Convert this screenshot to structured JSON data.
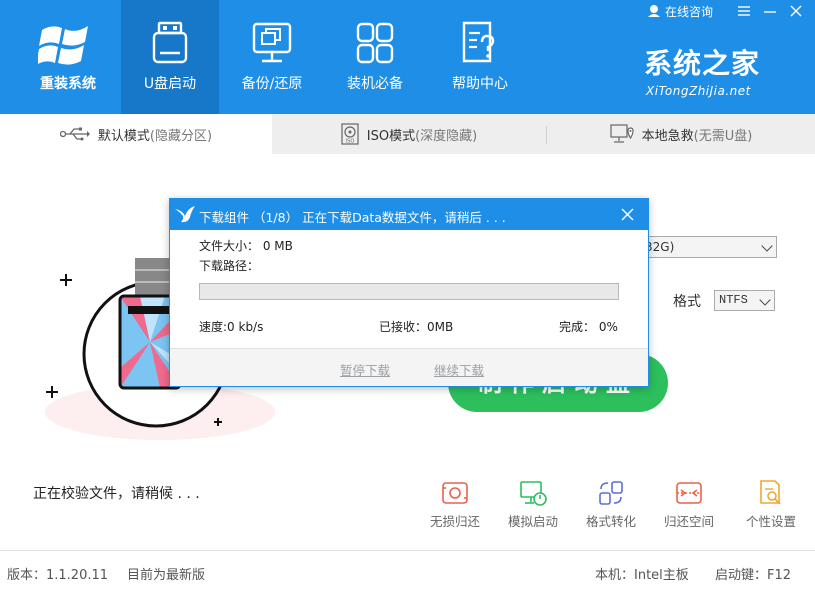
{
  "app": {
    "name": "重装系统"
  },
  "nav": [
    {
      "label": "U盘启动",
      "icon": "usb-drive-icon",
      "active": true
    },
    {
      "label": "备份/还原",
      "icon": "backup-restore-icon",
      "active": false
    },
    {
      "label": "装机必备",
      "icon": "apps-grid-icon",
      "active": false
    },
    {
      "label": "帮助中心",
      "icon": "help-document-icon",
      "active": false
    }
  ],
  "top_right": {
    "consult": "在线咨询"
  },
  "brand": {
    "zh": "系统之家",
    "en": "XiTongZhiJia.net"
  },
  "tabs": [
    {
      "label": "默认模式",
      "hint": "(隐藏分区)",
      "icon": "usb-plug-icon",
      "active": true
    },
    {
      "label": "ISO模式",
      "hint": "(深度隐藏)",
      "icon": "iso-disc-icon",
      "active": false
    },
    {
      "label": "本地急救",
      "hint": "(无需U盘)",
      "icon": "local-rescue-icon",
      "active": false
    }
  ],
  "main": {
    "device_value": "32G)",
    "format_label": "格式",
    "format_value": "NTFS",
    "start_button": "制作启动盘",
    "status": "正在校验文件，请稍候 . . ."
  },
  "tools": [
    {
      "label": "无损归还",
      "icon": "restore-icon",
      "color": "#e8624a"
    },
    {
      "label": "模拟启动",
      "icon": "simulate-boot-icon",
      "color": "#2cbf5c"
    },
    {
      "label": "格式转化",
      "icon": "format-convert-icon",
      "color": "#5b6fd8"
    },
    {
      "label": "归还空间",
      "icon": "return-space-icon",
      "color": "#e8624a"
    },
    {
      "label": "个性设置",
      "icon": "personalize-icon",
      "color": "#f0a830"
    }
  ],
  "footer": {
    "version": "版本：1.1.20.11",
    "latest": "目前为最新版",
    "board": "本机：Intel主板",
    "hotkey": "启动键：F12"
  },
  "dialog": {
    "title": "下载组件 （1/8） 正在下载Data数据文件，请稍后 . . .",
    "file_size": "文件大小： 0 MB",
    "download_path": "下载路径：",
    "progress": 0,
    "speed": "速度:0 kb/s",
    "received": "已接收：0MB",
    "complete": "完成： 0%",
    "pause": "暂停下载",
    "resume": "继续下载"
  },
  "colors": {
    "primary": "#1f8ee6",
    "primary_dark": "#1777c8",
    "start_green": "#2cbf5c"
  }
}
